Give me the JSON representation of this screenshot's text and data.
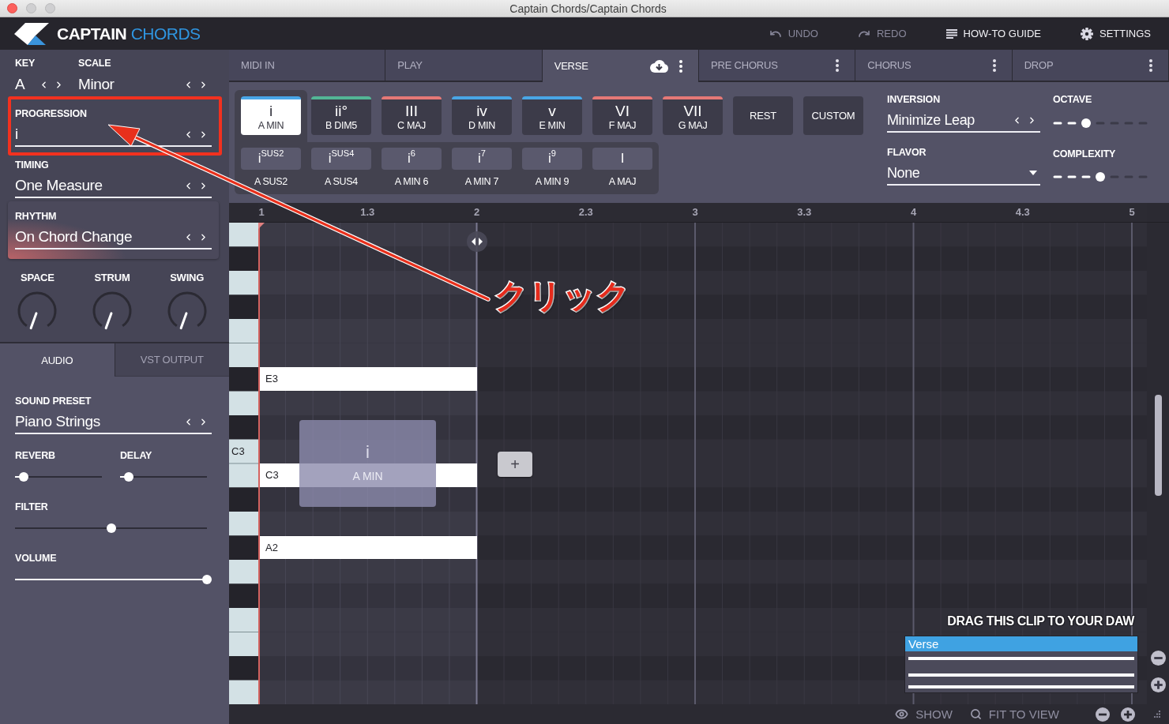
{
  "window": {
    "title": "Captain Chords/Captain Chords",
    "controls": [
      {
        "kind": "close",
        "disabled": false
      },
      {
        "kind": "minimize",
        "disabled": true
      },
      {
        "kind": "zoom",
        "disabled": true
      }
    ]
  },
  "header": {
    "logo": {
      "primary": "CAPTAIN",
      "secondary": "CHORDS"
    },
    "actions": [
      {
        "kind": "undo",
        "label": "UNDO",
        "disabled": true
      },
      {
        "kind": "redo",
        "label": "REDO",
        "disabled": true
      },
      {
        "kind": "guide",
        "label": "HOW-TO GUIDE",
        "disabled": false
      },
      {
        "kind": "settings",
        "label": "SETTINGS",
        "disabled": false
      }
    ]
  },
  "sidebar": {
    "key": {
      "label": "KEY",
      "value": "A"
    },
    "scale": {
      "label": "SCALE",
      "value": "Minor"
    },
    "progression": {
      "label": "PROGRESSION",
      "value": "i"
    },
    "timing": {
      "label": "TIMING",
      "value": "One Measure"
    },
    "rhythm": {
      "label": "RHYTHM",
      "value": "On Chord Change"
    },
    "knobs": [
      {
        "label": "SPACE",
        "level": 0
      },
      {
        "label": "STRUM",
        "level": 0
      },
      {
        "label": "SWING",
        "level": 0
      }
    ],
    "tabs": [
      {
        "label": "AUDIO",
        "selected": true
      },
      {
        "label": "VST OUTPUT",
        "selected": false
      }
    ],
    "sound_preset": {
      "label": "SOUND PRESET",
      "value": "Piano Strings"
    },
    "sliders": [
      {
        "label": "REVERB",
        "kind": "short",
        "level": 0.1
      },
      {
        "label": "DELAY",
        "kind": "short",
        "level": 0.1
      },
      {
        "label": "FILTER",
        "kind": "bipolar",
        "level": 0.5
      },
      {
        "label": "VOLUME",
        "kind": "full",
        "level": 1
      }
    ]
  },
  "sections": [
    {
      "label": "MIDI IN",
      "kind": "source",
      "selected": false
    },
    {
      "label": "PLAY",
      "kind": "source",
      "selected": false
    },
    {
      "label": "VERSE",
      "kind": "section",
      "selected": true
    },
    {
      "label": "PRE CHORUS",
      "kind": "section",
      "selected": false
    },
    {
      "label": "CHORUS",
      "kind": "section",
      "selected": false
    },
    {
      "label": "DROP",
      "kind": "section",
      "selected": false
    }
  ],
  "chords": {
    "items": [
      {
        "numeral": "i",
        "name": "A MIN",
        "color": "#49a6e6",
        "selected": true
      },
      {
        "numeral": "ii°",
        "name": "B DIM5",
        "color": "#53b696",
        "selected": false
      },
      {
        "numeral": "III",
        "name": "C MAJ",
        "color": "#e57876",
        "selected": false
      },
      {
        "numeral": "iv",
        "name": "D MIN",
        "color": "#49a6e6",
        "selected": false
      },
      {
        "numeral": "v",
        "name": "E MIN",
        "color": "#49a6e6",
        "selected": false
      },
      {
        "numeral": "VI",
        "name": "F MAJ",
        "color": "#e57876",
        "selected": false
      },
      {
        "numeral": "VII",
        "name": "G MAJ",
        "color": "#e57876",
        "selected": false
      }
    ],
    "extra_buttons": [
      "REST",
      "CUSTOM"
    ],
    "variations": [
      {
        "numeral": "i$^{SUS2}$",
        "name": "A SUS2"
      },
      {
        "numeral": "i$^{SUS4}$",
        "name": "A SUS4"
      },
      {
        "numeral": "i$^{6}$",
        "name": "A MIN 6"
      },
      {
        "numeral": "i$^{7}$",
        "name": "A MIN 7"
      },
      {
        "numeral": "i$^{9}$",
        "name": "A MIN 9"
      },
      {
        "numeral": "I",
        "name": "A MAJ"
      }
    ],
    "inversion": {
      "label": "INVERSION",
      "value": "Minimize Leap"
    },
    "flavor": {
      "label": "FLAVOR",
      "value": "None"
    },
    "octave": {
      "label": "OCTAVE",
      "level": 0.333
    },
    "complexity": {
      "label": "COMPLEXITY",
      "level": 0.5
    }
  },
  "piano_roll": {
    "ruler": [
      "1",
      "1.3",
      "2",
      "2.3",
      "3",
      "3.3",
      "4",
      "4.3",
      "5"
    ],
    "key_label": "C3",
    "notes": [
      {
        "label": "E3"
      },
      {
        "label": "C3"
      },
      {
        "label": "A2"
      }
    ],
    "chord_block": {
      "numeral": "i",
      "name": "A MIN"
    },
    "add_button": "+",
    "drag_hint": "DRAG THIS CLIP TO YOUR DAW",
    "clip": {
      "name": "Verse"
    }
  },
  "status_bar": {
    "actions": [
      {
        "kind": "show",
        "label": "SHOW"
      },
      {
        "kind": "fit",
        "label": "FIT TO VIEW"
      }
    ]
  },
  "annotation": {
    "text": "クリック"
  }
}
